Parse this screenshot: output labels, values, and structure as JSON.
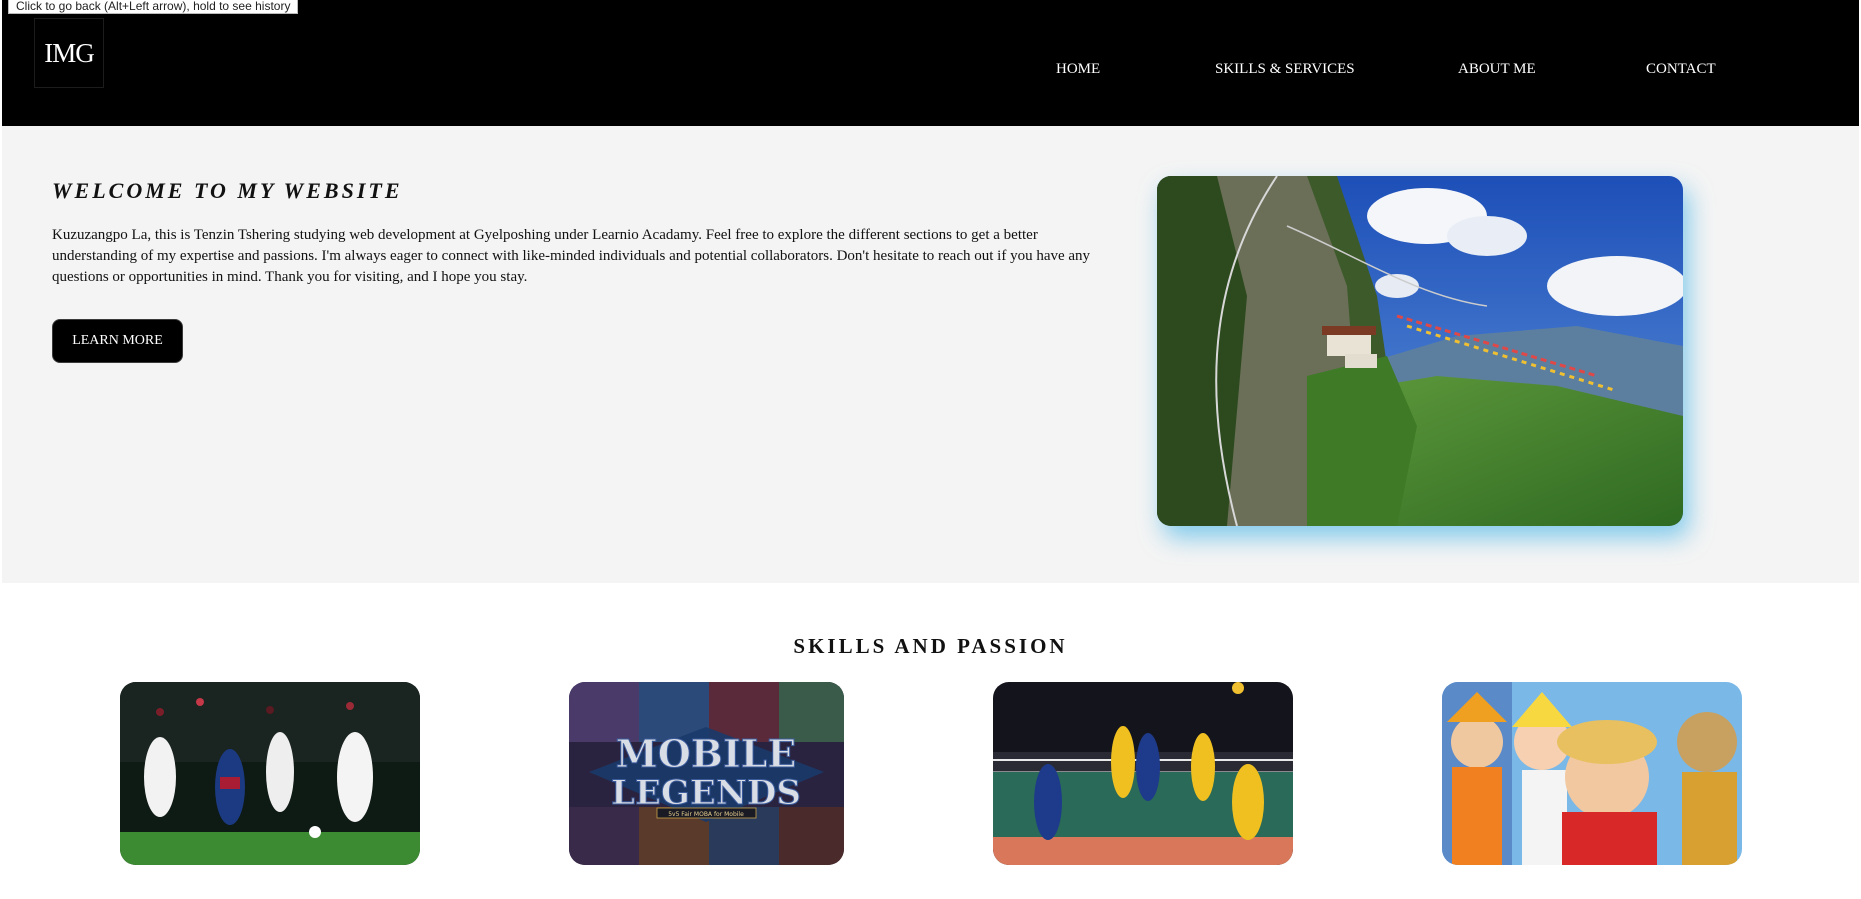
{
  "browser": {
    "back_tooltip": "Click to go back (Alt+Left arrow), hold to see history"
  },
  "header": {
    "logo_text": "IMG",
    "nav": [
      "HOME",
      "SKILLS & SERVICES",
      "ABOUT ME",
      "CONTACT"
    ]
  },
  "hero": {
    "title": "WELCOME TO MY WEBSITE",
    "text": "Kuzuzangpo La, this is Tenzin Tshering studying web development at Gyelposhing under Learnio Acadamy. Feel free to explore the different sections to get a better understanding of my expertise and passions. I'm always eager to connect with like-minded individuals and potential collaborators. Don't hesitate to reach out if you have any questions or opportunities in mind. Thank you for visiting, and I hope you stay.",
    "button_label": "LEARN MORE",
    "image_icon": "tigers-nest-monastery-photo"
  },
  "skills": {
    "title": "SKILLS AND PASSION",
    "cards": [
      {
        "icon": "football-photo"
      },
      {
        "icon": "mobile-legends-photo",
        "logo_line1": "MOBILE",
        "logo_line2": "LEGENDS",
        "logo_sub": "5v5 Fair MOBA for Mobile"
      },
      {
        "icon": "volleyball-photo"
      },
      {
        "icon": "anime-photo"
      }
    ]
  },
  "colors": {
    "navbar_bg": "#000000",
    "hero_bg": "#f4f4f4",
    "button_bg": "#000000",
    "image_shadow": "#28aae6"
  }
}
